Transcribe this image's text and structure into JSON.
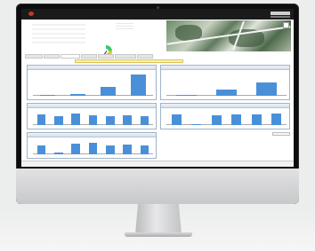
{
  "app": {
    "brand_name": "",
    "nav_items": [
      "",
      "",
      "",
      ""
    ]
  },
  "info": {
    "rows": [
      {
        "k": "",
        "v": ""
      },
      {
        "k": "",
        "v": ""
      },
      {
        "k": "",
        "v": ""
      },
      {
        "k": "",
        "v": ""
      },
      {
        "k": "",
        "v": ""
      },
      {
        "k": "",
        "v": ""
      }
    ],
    "gauge_label": ""
  },
  "tabs": [
    "",
    "",
    "",
    "",
    "",
    "",
    ""
  ],
  "alert_text": "",
  "panels": [
    {
      "title": "",
      "series": [
        5,
        8,
        40,
        95
      ],
      "labels": [
        "",
        "",
        "",
        ""
      ]
    },
    {
      "title": "",
      "series": [
        4,
        30,
        60
      ],
      "labels": [
        "",
        "",
        ""
      ]
    },
    {
      "title": "",
      "series": [
        80,
        70,
        85,
        75,
        65,
        72,
        68
      ],
      "labels": [
        "",
        "",
        "",
        "",
        "",
        "",
        ""
      ]
    },
    {
      "title": "",
      "series": [
        82,
        10,
        75,
        82,
        78,
        84
      ],
      "labels": [
        "",
        "",
        "",
        "",
        "",
        ""
      ]
    },
    {
      "title": "",
      "series": [
        70,
        15,
        78,
        85,
        70,
        72,
        68
      ],
      "labels": [
        "",
        "",
        "",
        "",
        "",
        "",
        ""
      ]
    }
  ],
  "status": {
    "left": "",
    "center": "",
    "right": ""
  },
  "colors": {
    "accent": "#4a90d9",
    "topbar": "#1b1b1b",
    "alert": "#fbf1a9"
  }
}
